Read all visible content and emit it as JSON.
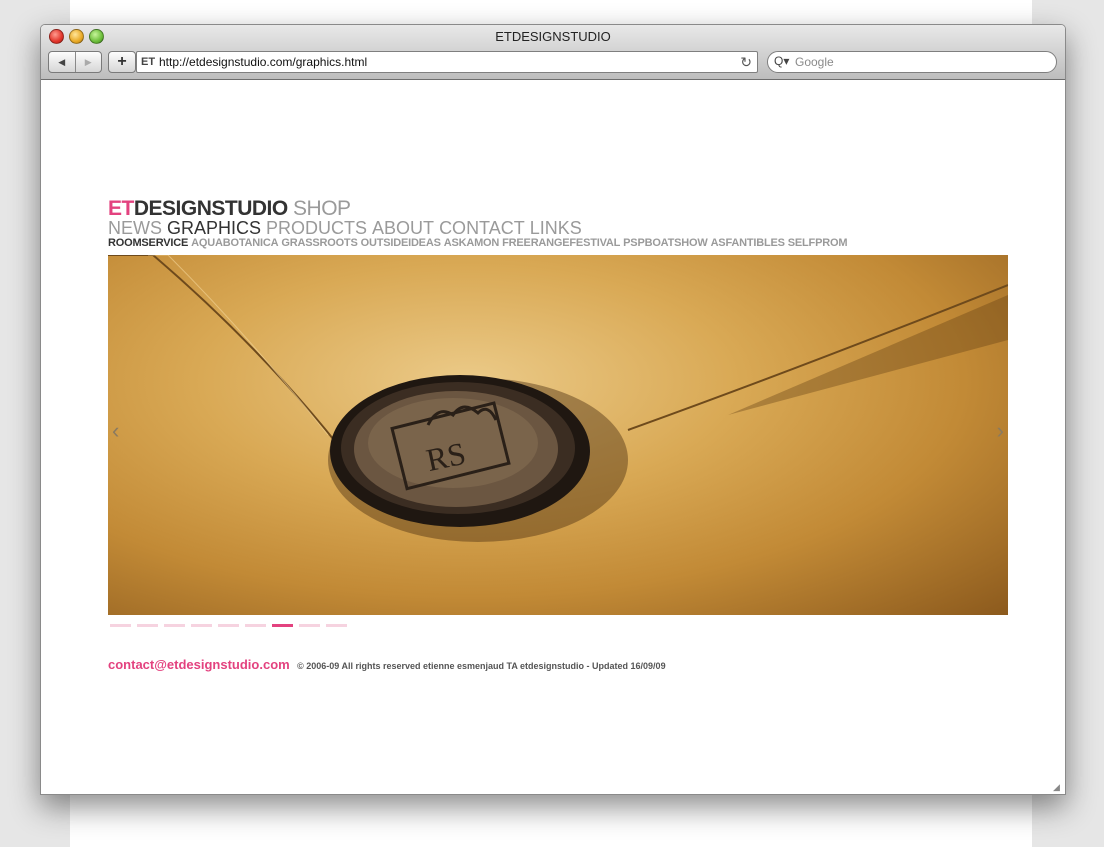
{
  "window": {
    "title": "ETDESIGNSTUDIO"
  },
  "browser": {
    "back_icon": "◀",
    "forward_icon": "▶",
    "add_icon": "+",
    "url_favicon": "ET",
    "url": "http://etdesignstudio.com/graphics.html",
    "reload_icon": "↻",
    "search_icon": "Q▾",
    "search_placeholder": "Google"
  },
  "site": {
    "brand": {
      "et": "ET",
      "designstudio": "DESIGNSTUDIO",
      "shop": "SHOP"
    },
    "main_nav": [
      "NEWS",
      "GRAPHICS",
      "PRODUCTS",
      "ABOUT",
      "CONTACT",
      "LINKS"
    ],
    "main_nav_active": "GRAPHICS",
    "sub_nav": [
      "ROOMSERVICE",
      "AQUABOTANICA",
      "GRASSROOTS",
      "OUTSIDEIDEAS",
      "ASKAMON",
      "FREERANGEFESTIVAL",
      "PSPBOATSHOW",
      "ASFANTIBLES",
      "SELFPROM"
    ],
    "sub_nav_active": "ROOMSERVICE",
    "slide": {
      "seal_text": "RS",
      "prev_icon": "‹",
      "next_icon": "›"
    },
    "slide_indicator": {
      "count": 9,
      "active_index": 6
    },
    "footer": {
      "email": "contact@etdesignstudio.com",
      "copyright": "© 2006-09 All rights reserved etienne esmenjaud TA etdesignstudio - Updated 16/09/09"
    }
  },
  "colors": {
    "accent": "#e3427f",
    "text_dark": "#333333",
    "text_grey": "#9a9a9a",
    "dot_inactive": "#f6d3e0"
  }
}
